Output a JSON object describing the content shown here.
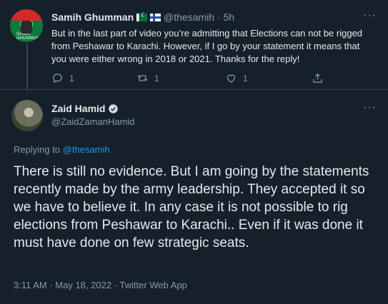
{
  "reply_tweet": {
    "author_name": "Samih Ghumman",
    "avatar_caption": "SAMIH GHUMMAN",
    "handle": "@thesamih",
    "separator": "·",
    "time": "5h",
    "text": "But in the last part of video you’re admitting that Elections can not be rigged from Peshawar to Karachi. However, if I go by your statement it means that you were either wrong in 2018 or 2021. Thanks for the reply!",
    "reply_count": "1",
    "retweet_count": "1",
    "like_count": "1",
    "more_label": "···"
  },
  "main_tweet": {
    "author_name": "Zaid Hamid",
    "handle": "@ZaidZamanHamid",
    "replying_to_label": "Replying to",
    "replying_to_handle": "@thesamih",
    "text": "There is still no evidence. But I am going by the statements recently made by the army leadership. They accepted it so we have to believe it. In any case it is not possible to rig elections from Peshawar to Karachi.. Even if it was done it must have done on few strategic seats.",
    "timestamp": "3:11 AM · May 18, 2022 · Twitter Web App",
    "more_label": "···"
  },
  "colors": {
    "background": "#15202b",
    "text": "#e7e9ea",
    "muted": "#8b98a5",
    "accent": "#1d9bf0",
    "divider": "#38444d"
  },
  "icons": [
    "reply-icon",
    "retweet-icon",
    "like-icon",
    "share-icon",
    "verified-badge-icon",
    "more-icon"
  ]
}
